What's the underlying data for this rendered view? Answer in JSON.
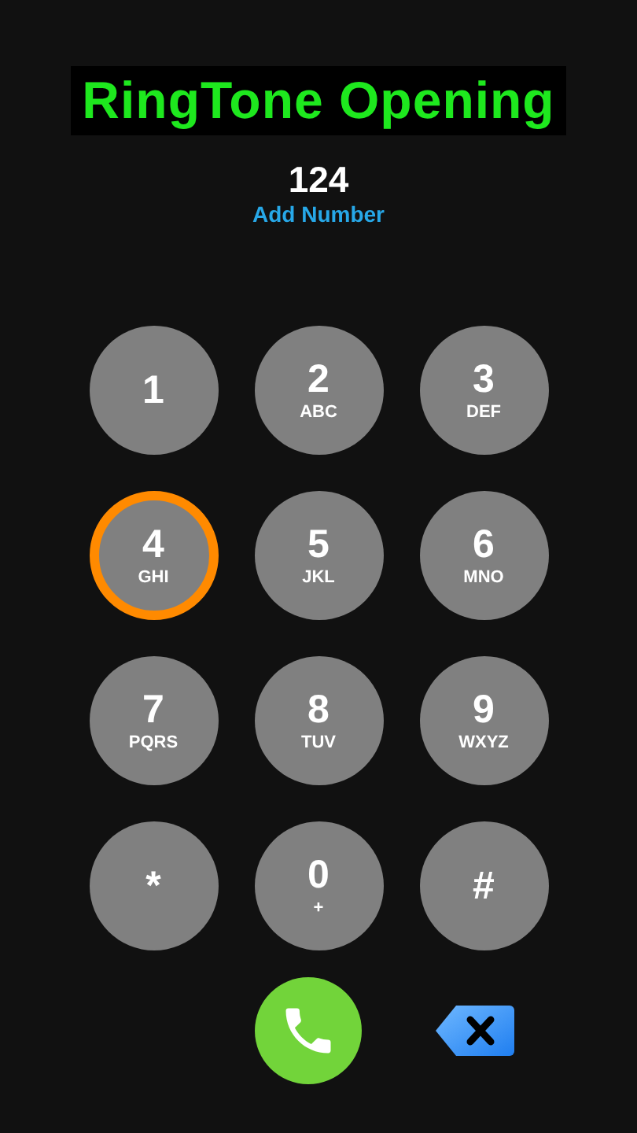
{
  "title": "RingTone Opening",
  "number": "124",
  "add_number": "Add Number",
  "keys": [
    {
      "digit": "1",
      "selected": false
    },
    {
      "digit": "2",
      "letters": "ABC",
      "selected": false
    },
    {
      "digit": "3",
      "letters": "DEF",
      "selected": false
    },
    {
      "digit": "4",
      "letters": "GHI",
      "selected": true
    },
    {
      "digit": "5",
      "letters": "JKL",
      "selected": false
    },
    {
      "digit": "6",
      "letters": "MNO",
      "selected": false
    },
    {
      "digit": "7",
      "letters": "PQRS",
      "selected": false
    },
    {
      "digit": "8",
      "letters": "TUV",
      "selected": false
    },
    {
      "digit": "9",
      "letters": "WXYZ",
      "selected": false
    },
    {
      "digit": "*",
      "selected": false
    },
    {
      "digit": "0",
      "letters": "+",
      "selected": false
    },
    {
      "digit": "#",
      "selected": false
    }
  ]
}
